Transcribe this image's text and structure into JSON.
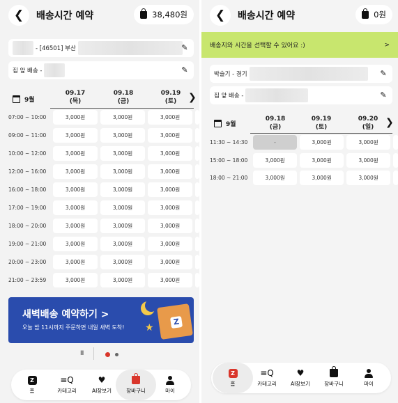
{
  "left": {
    "title": "배송시간 예약",
    "cart_total": "38,480원",
    "address": {
      "prefix": "- [46501] 부산"
    },
    "entrance": {
      "prefix": "집 앞 배송 -"
    },
    "month": "9월",
    "dates": [
      {
        "date": "09.17",
        "day": "(목)"
      },
      {
        "date": "09.18",
        "day": "(금)"
      },
      {
        "date": "09.19",
        "day": "(토)"
      }
    ],
    "slots": [
      {
        "time": "07:00 ~ 10:00",
        "prices": [
          "3,000원",
          "3,000원",
          "3,000원"
        ]
      },
      {
        "time": "09:00 ~ 11:00",
        "prices": [
          "3,000원",
          "3,000원",
          "3,000원"
        ]
      },
      {
        "time": "10:00 ~ 12:00",
        "prices": [
          "3,000원",
          "3,000원",
          "3,000원"
        ]
      },
      {
        "time": "12:00 ~ 16:00",
        "prices": [
          "3,000원",
          "3,000원",
          "3,000원"
        ]
      },
      {
        "time": "16:00 ~ 18:00",
        "prices": [
          "3,000원",
          "3,000원",
          "3,000원"
        ]
      },
      {
        "time": "17:00 ~ 19:00",
        "prices": [
          "3,000원",
          "3,000원",
          "3,000원"
        ]
      },
      {
        "time": "18:00 ~ 20:00",
        "prices": [
          "3,000원",
          "3,000원",
          "3,000원"
        ]
      },
      {
        "time": "19:00 ~ 21:00",
        "prices": [
          "3,000원",
          "3,000원",
          "3,000원"
        ]
      },
      {
        "time": "20:00 ~ 23:00",
        "prices": [
          "3,000원",
          "3,000원",
          "3,000원"
        ]
      },
      {
        "time": "21:00 ~ 23:59",
        "prices": [
          "3,000원",
          "3,000원",
          "3,000원"
        ]
      }
    ],
    "promo": {
      "headline": "새벽배송 예약하기 >",
      "subtext": "오늘 밤 11시까지 주문하면 내일 새벽 도착!",
      "box_letter": "Z"
    },
    "pager": {
      "pause": "II"
    }
  },
  "right": {
    "title": "배송시간 예약",
    "cart_total": "0원",
    "banner": "배송지와 시간을 선택할 수 있어요 :)",
    "banner_arrow": ">",
    "address": {
      "prefix": "박슬기 - 경기"
    },
    "entrance": {
      "prefix": "집 앞 배송 -"
    },
    "month": "9월",
    "dates": [
      {
        "date": "09.18",
        "day": "(금)"
      },
      {
        "date": "09.19",
        "day": "(토)"
      },
      {
        "date": "09.20",
        "day": "(일)"
      }
    ],
    "slots": [
      {
        "time": "11:30 ~ 14:30",
        "prices": [
          "-",
          "3,000원",
          "3,000원"
        ]
      },
      {
        "time": "15:00 ~ 18:00",
        "prices": [
          "3,000원",
          "3,000원",
          "3,000원"
        ]
      },
      {
        "time": "18:00 ~ 21:00",
        "prices": [
          "3,000원",
          "3,000원",
          "3,000원"
        ]
      }
    ]
  },
  "nav": [
    {
      "label": "홈",
      "icon": "home-icon"
    },
    {
      "label": "카테고리",
      "icon": "category-icon"
    },
    {
      "label": "AI장보기",
      "icon": "heart-icon"
    },
    {
      "label": "장바구니",
      "icon": "cart-icon"
    },
    {
      "label": "마이",
      "icon": "person-icon"
    }
  ],
  "colors": {
    "accent_red": "#d9362b",
    "banner_green": "#c8e66e",
    "promo_blue": "#2a4cad",
    "disabled_slot": "#cfcfcf"
  }
}
